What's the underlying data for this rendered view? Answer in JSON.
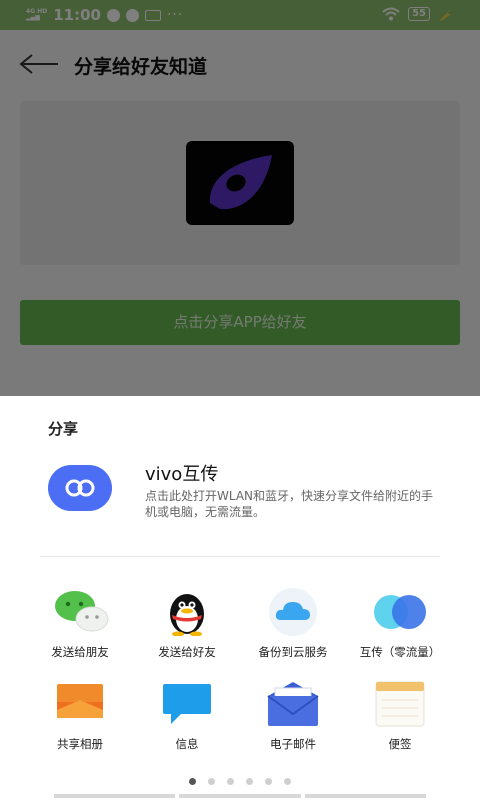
{
  "status_bar": {
    "network": "4G HD",
    "time": "11:00",
    "dots": "···",
    "battery": "55"
  },
  "app": {
    "title": "分享给好友知道",
    "share_button": "点击分享APP给好友"
  },
  "sheet": {
    "title": "分享",
    "vivo": {
      "name": "vivo互传",
      "description": "点击此处打开WLAN和蓝牙，快速分享文件给附近的手机或电脑，无需流量。"
    },
    "row1": [
      {
        "label": "发送给朋友",
        "icon": "wechat-icon"
      },
      {
        "label": "发送给好友",
        "icon": "qq-icon"
      },
      {
        "label": "备份到云服务",
        "icon": "cloud-icon"
      },
      {
        "label": "互传（零流量）",
        "icon": "transfer-icon"
      }
    ],
    "row2": [
      {
        "label": "共享相册",
        "icon": "album-icon"
      },
      {
        "label": "信息",
        "icon": "message-icon"
      },
      {
        "label": "电子邮件",
        "icon": "email-icon"
      },
      {
        "label": "便签",
        "icon": "notes-icon"
      }
    ],
    "page_count": 6,
    "active_page": 1
  },
  "colors": {
    "accent_green": "#66b74e",
    "vivo_blue": "#4c6ef5",
    "status_green": "#8fbf6f"
  }
}
